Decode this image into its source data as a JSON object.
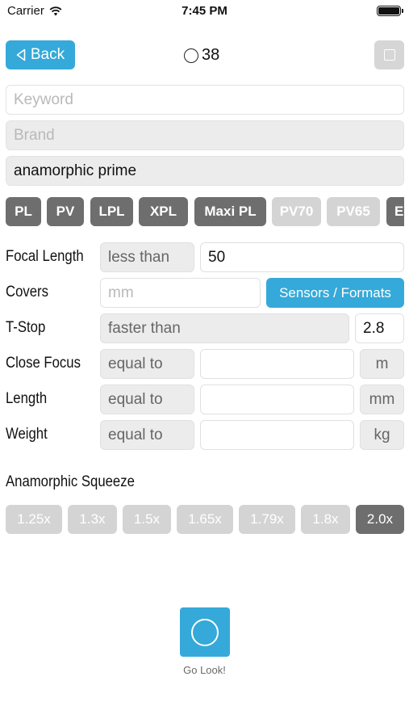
{
  "status_bar": {
    "carrier": "Carrier",
    "time": "7:45 PM"
  },
  "nav": {
    "back_label": "Back",
    "count": "38"
  },
  "fields": {
    "keyword_placeholder": "Keyword",
    "brand_placeholder": "Brand",
    "series_value": "anamorphic prime"
  },
  "mounts": [
    {
      "label": "PL",
      "selected": true
    },
    {
      "label": "PV",
      "selected": true
    },
    {
      "label": "LPL",
      "selected": true
    },
    {
      "label": "XPL",
      "selected": true
    },
    {
      "label": "Maxi PL",
      "selected": true
    },
    {
      "label": "PV70",
      "selected": false
    },
    {
      "label": "PV65",
      "selected": false
    },
    {
      "label": "E",
      "selected": true
    }
  ],
  "filters": {
    "focal_length": {
      "label": "Focal Length",
      "operator": "less than",
      "value": "50"
    },
    "covers": {
      "label": "Covers",
      "placeholder": "mm",
      "button": "Sensors / Formats"
    },
    "t_stop": {
      "label": "T-Stop",
      "operator": "faster than",
      "value": "2.8"
    },
    "close_focus": {
      "label": "Close Focus",
      "operator": "equal to",
      "value": "",
      "unit": "m"
    },
    "length": {
      "label": "Length",
      "operator": "equal to",
      "value": "",
      "unit": "mm"
    },
    "weight": {
      "label": "Weight",
      "operator": "equal to",
      "value": "",
      "unit": "kg"
    }
  },
  "squeeze": {
    "title": "Anamorphic Squeeze",
    "options": [
      {
        "label": "1.25x",
        "selected": false
      },
      {
        "label": "1.3x",
        "selected": false
      },
      {
        "label": "1.5x",
        "selected": false
      },
      {
        "label": "1.65x",
        "selected": false
      },
      {
        "label": "1.79x",
        "selected": false
      },
      {
        "label": "1.8x",
        "selected": false
      },
      {
        "label": "2.0x",
        "selected": true
      }
    ]
  },
  "go": {
    "label": "Go Look!"
  },
  "colors": {
    "accent": "#35a9d9",
    "chip_selected": "#6e6e6e",
    "chip_unselected": "#d4d4d4"
  }
}
